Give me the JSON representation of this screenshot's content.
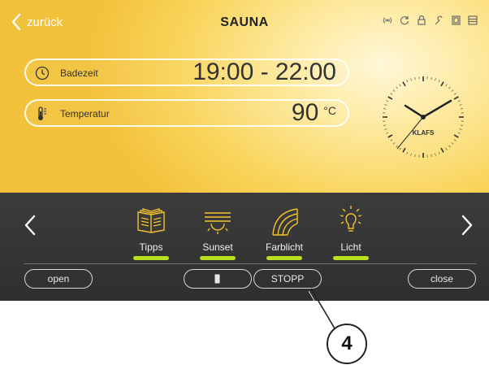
{
  "header": {
    "back_label": "zurück",
    "title": "SAUNA",
    "status_icons": [
      "wifi-icon",
      "sync-icon",
      "lock-icon",
      "wrench-icon",
      "door-icon",
      "menu-icon"
    ]
  },
  "info": {
    "bath_time_label": "Badezeit",
    "bath_time_value": "19:00 - 22:00",
    "temperature_label": "Temperatur",
    "temperature_value": "90",
    "temperature_unit": "°C"
  },
  "clock": {
    "brand": "KLAFS"
  },
  "features": [
    {
      "label": "Tipps",
      "icon": "book-icon",
      "active": true
    },
    {
      "label": "Sunset",
      "icon": "sunset-icon",
      "active": true
    },
    {
      "label": "Farblicht",
      "icon": "rainbow-icon",
      "active": true
    },
    {
      "label": "Licht",
      "icon": "bulb-icon",
      "active": true
    }
  ],
  "controls": {
    "open_label": "open",
    "stop_label": "STOPP",
    "close_label": "close"
  },
  "callout": {
    "number": "4"
  },
  "colors": {
    "accent_green": "#b8e01e",
    "icon_yellow": "#f2c22e",
    "panel_dark": "#333333"
  }
}
